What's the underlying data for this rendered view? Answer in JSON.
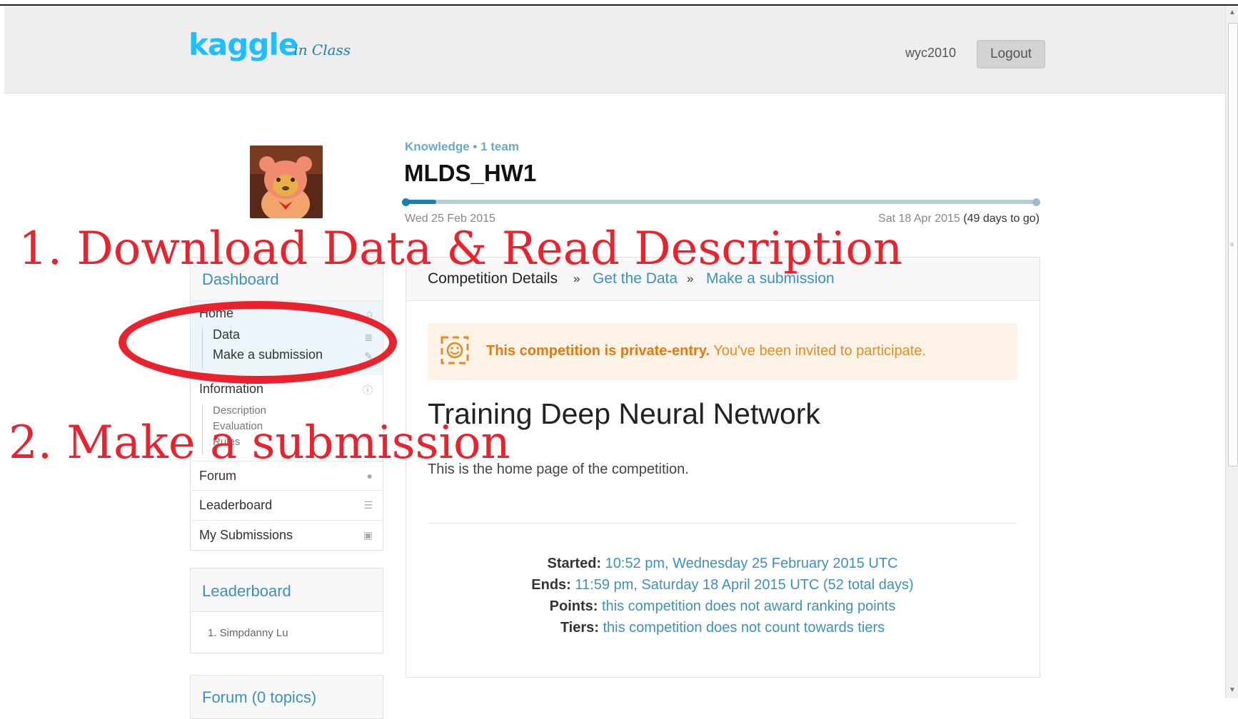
{
  "header": {
    "logo_main": "kaggle",
    "logo_sub": "in Class",
    "username": "wyc2010",
    "logout_label": "Logout"
  },
  "competition": {
    "type_line": "Knowledge • 1 team",
    "title": "MLDS_HW1",
    "start_date": "Wed 25 Feb 2015",
    "end_date": "Sat 18 Apr 2015",
    "days_to_go": "(49 days to go)",
    "progress_fraction": 0.05
  },
  "nav": {
    "dashboard": "Dashboard",
    "home": "Home",
    "data": "Data",
    "make_submission": "Make a submission",
    "information": "Information",
    "description": "Description",
    "evaluation": "Evaluation",
    "rules": "Rules",
    "forum": "Forum",
    "leaderboard": "Leaderboard",
    "my_submissions": "My Submissions"
  },
  "leaderboard_box": {
    "title": "Leaderboard",
    "entry": "1. Simpdanny Lu"
  },
  "forum_box": {
    "title": "Forum (0 topics)"
  },
  "breadcrumb": {
    "details": "Competition Details",
    "sep": "»",
    "get_data": "Get the Data",
    "make_submission": "Make a submission"
  },
  "notice": {
    "bold": "This competition is private-entry.",
    "rest": " You've been invited to participate."
  },
  "main": {
    "heading": "Training Deep Neural Network",
    "description": "This is the home page of the competition.",
    "started_label": "Started:",
    "started_value": " 10:52 pm, Wednesday 25 February 2015 UTC",
    "ends_label": "Ends:",
    "ends_value": " 11:59 pm, Saturday 18 April 2015 UTC (52 total days)",
    "points_label": "Points:",
    "points_value": " this competition does not award ",
    "points_link": "ranking points",
    "tiers_label": "Tiers:",
    "tiers_value": " this competition does not count towards ",
    "tiers_link": "tiers"
  },
  "annotations": {
    "step1": "1. Download Data & Read Description",
    "step2": "2. Make a submission"
  },
  "colors": {
    "accent": "#3d8fbf",
    "annotation": "#e8232d",
    "notice_bg": "#fdf2e6"
  }
}
